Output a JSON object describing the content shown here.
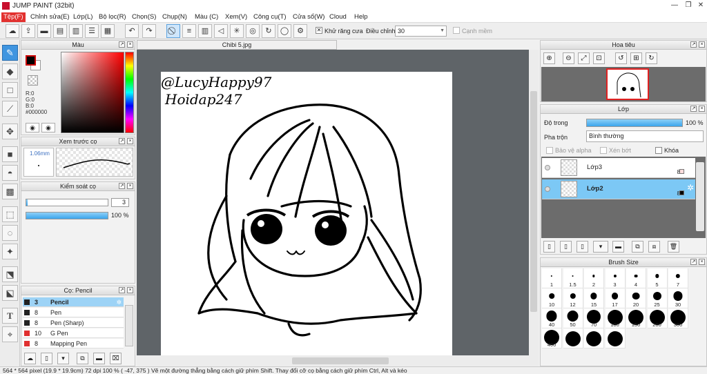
{
  "app": {
    "title": "JUMP PAINT (32bit)"
  },
  "menu": [
    "Tệp(F)",
    "Chỉnh sửa(E)",
    "Lớp(L)",
    "Bộ lọc(R)",
    "Chọn(S)",
    "Chụp(N)",
    "Màu (C)",
    "Xem(V)",
    "Công cụ(T)",
    "Cửa sổ(W)",
    "Cloud",
    "Help"
  ],
  "toolbar": {
    "antialias_label": "Khử răng cưa",
    "correction_label": "Điều chỉnh",
    "correction_value": "30",
    "snap_label": "Cạnh mềm"
  },
  "color_panel": {
    "title": "Màu",
    "r": "R:0",
    "g": "G:0",
    "b": "B:0",
    "hex": "#000000",
    "main_color": "#000000",
    "sub_color": "#ffffff"
  },
  "brush_preview": {
    "title": "Xem trước cọ",
    "size": "1.06mm"
  },
  "brush_control": {
    "title": "Kiểm soát cọ",
    "size_value": "3",
    "opacity_value": "100",
    "opacity_unit": "%",
    "opacity_fraction": 1.0
  },
  "brush_list": {
    "title": "Cọ: Pencil",
    "items": [
      {
        "num": "3",
        "name": "Pencil",
        "color": "#222222",
        "selected": true
      },
      {
        "num": "8",
        "name": "Pen",
        "color": "#222222"
      },
      {
        "num": "8",
        "name": "Pen (Sharp)",
        "color": "#222222"
      },
      {
        "num": "10",
        "name": "G Pen",
        "color": "#e03030"
      },
      {
        "num": "8",
        "name": "Mapping Pen",
        "color": "#e03030"
      }
    ]
  },
  "document": {
    "tab": "Chibi 5.jpg",
    "watermark_line1": "@LucyHappy97",
    "watermark_line2": "Hoidap247"
  },
  "navigator": {
    "title": "Hoa tiêu"
  },
  "layers": {
    "title": "Lớp",
    "opacity_label": "Độ trong",
    "opacity_value": "100 %",
    "opacity_fraction": 1.0,
    "blend_label": "Pha trộn",
    "blend_value": "Bình thường",
    "protect_alpha": "Bảo vệ alpha",
    "clipping": "Xén bớt",
    "lock": "Khóa",
    "items": [
      {
        "name": "Lớp3",
        "num": "8",
        "selected": false
      },
      {
        "name": "Lớp2",
        "num": "8",
        "selected": true
      }
    ]
  },
  "brush_size": {
    "title": "Brush Size",
    "sizes": [
      "1",
      "1.5",
      "2",
      "3",
      "4",
      "5",
      "7",
      "10",
      "12",
      "15",
      "17",
      "20",
      "25",
      "30",
      "40",
      "50",
      "70",
      "100",
      "150",
      "200",
      "300",
      "400",
      "",
      "",
      ""
    ]
  },
  "status": {
    "text": "564 * 564 pixel   (19.9 * 19.9cm)   72 dpi   100 %   ( -47, 375 )   Vẽ một đường thẳng bằng cách giữ phím Shift. Thay đổi cỡ cọ bằng cách giữ phím Ctrl, Alt và kéo"
  }
}
